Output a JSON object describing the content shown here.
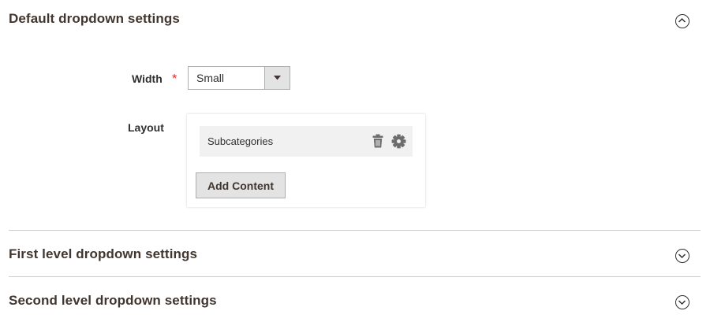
{
  "sections": [
    {
      "title": "Default dropdown settings",
      "state": "expanded"
    },
    {
      "title": "First level dropdown settings",
      "state": "collapsed"
    },
    {
      "title": "Second level dropdown settings",
      "state": "collapsed"
    }
  ],
  "width_field": {
    "label": "Width",
    "required_marker": "*",
    "selected_value": "Small"
  },
  "layout_field": {
    "label": "Layout",
    "items": [
      {
        "label": "Subcategories",
        "actions": [
          "trash-icon",
          "gear-icon"
        ]
      }
    ],
    "add_button_label": "Add Content"
  },
  "colors": {
    "required": "#e22626",
    "button_bg": "#e3e3e3",
    "item_bg": "#f1f1f1",
    "divider": "#cccccc"
  }
}
